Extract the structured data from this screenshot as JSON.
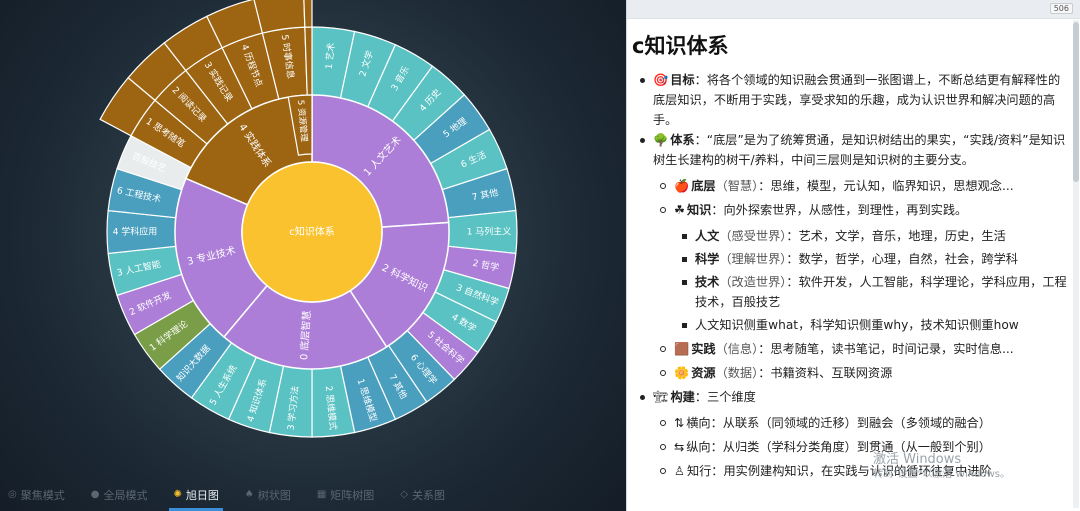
{
  "sunburst": {
    "center": {
      "label": "c知识体系",
      "color": "#f9c22e"
    },
    "ring1": [
      {
        "label": "1 人文艺术",
        "start": 0,
        "end": 86,
        "color": "#ad7ed8"
      },
      {
        "label": "2 科学知识",
        "start": 86,
        "end": 147,
        "color": "#ad7ed8"
      },
      {
        "label": "0 底层智慧",
        "start": 147,
        "end": 220,
        "color": "#ad7ed8"
      },
      {
        "label": "3 专业技术",
        "start": 220,
        "end": 293,
        "color": "#ad7ed8"
      },
      {
        "label": "4 实践体系",
        "start": 293,
        "end": 360,
        "color": "#9d6412"
      }
    ],
    "ring2": [
      {
        "label": "1 艺术",
        "start": 0,
        "end": 12,
        "color": "#5ac2c2"
      },
      {
        "label": "2 文学",
        "start": 12,
        "end": 24,
        "color": "#5ac2c2"
      },
      {
        "label": "3 音乐",
        "start": 24,
        "end": 36,
        "color": "#5ac2c2"
      },
      {
        "label": "4 历史",
        "start": 36,
        "end": 48,
        "color": "#5ac2c2"
      },
      {
        "label": "5 地理",
        "start": 48,
        "end": 60,
        "color": "#4a9fbf"
      },
      {
        "label": "6 生活",
        "start": 60,
        "end": 72,
        "color": "#5ac2c2"
      },
      {
        "label": "7 其他",
        "start": 72,
        "end": 84,
        "color": "#4a9fbf"
      },
      {
        "label": "1 马列主义",
        "start": 84,
        "end": 96,
        "color": "#5ac2c2"
      },
      {
        "label": "2 哲学",
        "start": 96,
        "end": 106,
        "color": "#ad7ed8"
      },
      {
        "label": "3 自然科学",
        "start": 106,
        "end": 116,
        "color": "#5ac2c2"
      },
      {
        "label": "4 数学",
        "start": 116,
        "end": 126,
        "color": "#5ac2c2"
      },
      {
        "label": "5 社会科学",
        "start": 126,
        "end": 136,
        "color": "#ad7ed8"
      },
      {
        "label": "6 心理学",
        "start": 136,
        "end": 146,
        "color": "#4a9fbf"
      },
      {
        "label": "7 其他",
        "start": 146,
        "end": 156,
        "color": "#4a9fbf"
      },
      {
        "label": "1 思维模型",
        "start": 156,
        "end": 168,
        "color": "#4a9fbf"
      },
      {
        "label": "2 思维模式",
        "start": 168,
        "end": 180,
        "color": "#5ac2c2"
      },
      {
        "label": "3 学习方法",
        "start": 180,
        "end": 192,
        "color": "#5ac2c2"
      },
      {
        "label": "4 知识体系",
        "start": 192,
        "end": 204,
        "color": "#5ac2c2"
      },
      {
        "label": "5 人生系统",
        "start": 204,
        "end": 216,
        "color": "#5ac2c2"
      },
      {
        "label": "知识大数据",
        "start": 216,
        "end": 228,
        "color": "#4a9fbf"
      },
      {
        "label": "1 科学理论",
        "start": 228,
        "end": 240,
        "color": "#7a9e47"
      },
      {
        "label": "2 软件开发",
        "start": 240,
        "end": 252,
        "color": "#ad7ed8"
      },
      {
        "label": "3 人工智能",
        "start": 252,
        "end": 264,
        "color": "#5ac2c2"
      },
      {
        "label": "4 学科应用",
        "start": 264,
        "end": 276,
        "color": "#4a9fbf"
      },
      {
        "label": "6 工程技术",
        "start": 276,
        "end": 288,
        "color": "#4a9fbf"
      },
      {
        "label": "百般技艺",
        "start": 288,
        "end": 298,
        "color": "#e9eced",
        "dark": true
      },
      {
        "label": "1 思考随笔",
        "start": 298,
        "end": 310,
        "color": "#9d6412"
      },
      {
        "label": "2 阅读记录",
        "start": 310,
        "end": 322,
        "color": "#9d6412"
      },
      {
        "label": "3 实践记录",
        "start": 322,
        "end": 334,
        "color": "#9d6412"
      },
      {
        "label": "4 历程节点",
        "start": 334,
        "end": 346,
        "color": "#9d6412"
      },
      {
        "label": "5 时事信息",
        "start": 346,
        "end": 358,
        "color": "#9d6412"
      },
      {
        "label": "6 考试知识",
        "start": 358,
        "end": 360,
        "color": "#9d6412"
      }
    ],
    "extras": [
      {
        "label": "5 资源管理",
        "color": "#9d6412"
      }
    ]
  },
  "tabs": [
    {
      "label": "聚焦模式",
      "icon": "target-icon",
      "glyph": "◎",
      "active": false
    },
    {
      "label": "全局模式",
      "icon": "globe-icon",
      "glyph": "●",
      "active": false
    },
    {
      "label": "旭日图",
      "icon": "sun-icon",
      "glyph": "✺",
      "active": true
    },
    {
      "label": "树状图",
      "icon": "tree-icon",
      "glyph": "♠",
      "active": false
    },
    {
      "label": "矩阵树图",
      "icon": "matrix-icon",
      "glyph": "▦",
      "active": false
    },
    {
      "label": "关系图",
      "icon": "relation-icon",
      "glyph": "◇",
      "active": false
    }
  ],
  "doc": {
    "word_count": "506",
    "title": "c知识体系",
    "goal": {
      "emoji": "🎯",
      "label": "目标",
      "text": "：将各个领域的知识融会贯通到一张图谱上，不断总结更有解释性的底层知识，不断用于实践，享受求知的乐趣，成为认识世界和解决问题的高手。"
    },
    "system": {
      "emoji": "🌳",
      "label": "体系",
      "text": "：“底层”是为了统筹贯通，是知识树结出的果实，“实践/资料”是知识树生长建构的树干/养料，中间三层则是知识树的主要分支。"
    },
    "bottom": {
      "emoji": "🍎",
      "label": "底层",
      "paren": "（智慧）",
      "text": "：思维，模型，元认知，临界知识，思想观念..."
    },
    "knowledge": {
      "emoji": "☘",
      "label": "知识",
      "text": "：向外探索世界，从感性，到理性，再到实践。"
    },
    "k_items": [
      {
        "label": "人文",
        "paren": "（感受世界）",
        "text": "：艺术，文学，音乐，地理，历史，生活"
      },
      {
        "label": "科学",
        "paren": "（理解世界）",
        "text": "：数学，哲学，心理，自然，社会，跨学科"
      },
      {
        "label": "技术",
        "paren": "（改造世界）",
        "text": "：软件开发，人工智能，科学理论，学科应用，工程技术，百般技艺"
      },
      {
        "label": "",
        "paren": "",
        "text": "人文知识侧重what，科学知识侧重why，技术知识侧重how"
      }
    ],
    "practice": {
      "emoji": "🟫",
      "label": "实践",
      "paren": "（信息）",
      "text": "：思考随笔，读书笔记，时间记录，实时信息..."
    },
    "resource": {
      "emoji": "🌼",
      "label": "资源",
      "paren": "（数据）",
      "text": "：书籍资料、互联网资源"
    },
    "build": {
      "emoji": "🏗",
      "label": "构建",
      "text": "：三个维度"
    },
    "b_items": [
      {
        "glyph": "⇅",
        "text": "横向：从联系（同领域的迁移）到融会（多领域的融合）"
      },
      {
        "glyph": "⇆",
        "text": "纵向：从归类（学科分类角度）到贯通（从一般到个别）"
      },
      {
        "glyph": "♙",
        "text": "知行：用实例建构知识，在实践与认识的循环往复中进阶"
      }
    ],
    "watermark": {
      "line1": "激活 Windows",
      "line2": "转到\"设置\"以激活 Windows。"
    }
  }
}
